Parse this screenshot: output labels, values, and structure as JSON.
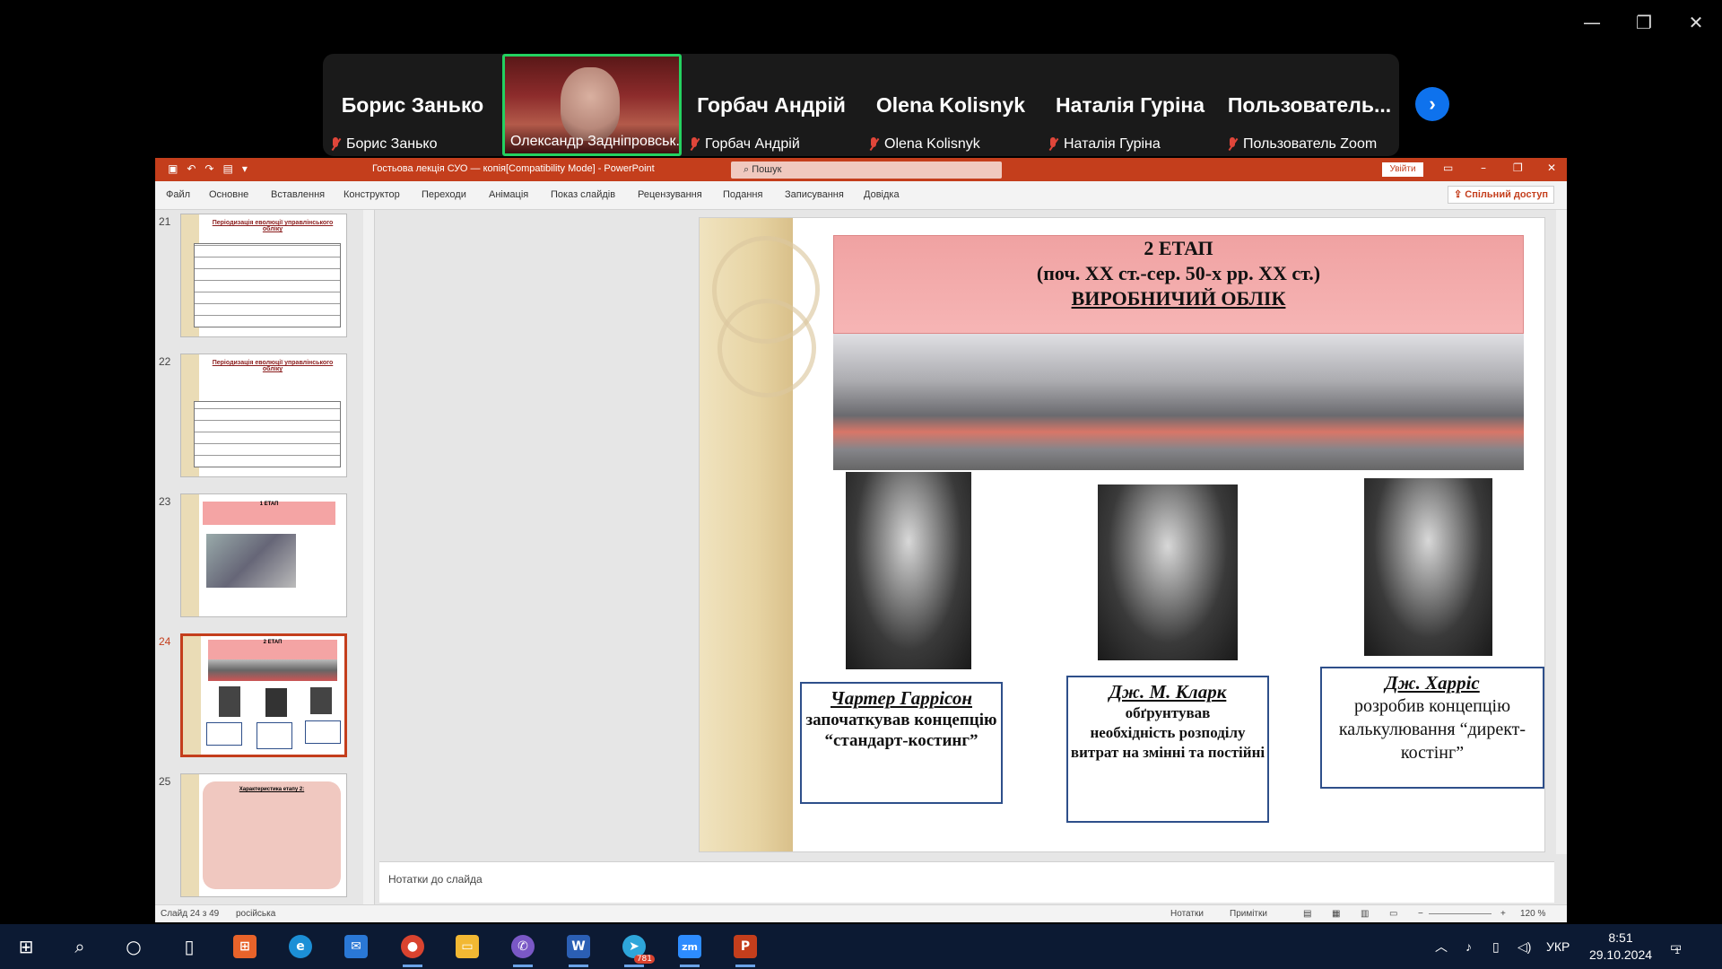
{
  "zoom": {
    "window_controls": [
      "—",
      "❐",
      "✕"
    ],
    "participants": [
      {
        "big_name": "Борис Занько",
        "label": "Борис Занько",
        "muted": true
      },
      {
        "big_name": "",
        "label": "Олександр Задніпровськ...",
        "muted": false,
        "video": true
      },
      {
        "big_name": "Горбач Андрій",
        "label": "Горбач Андрій",
        "muted": true
      },
      {
        "big_name": "Olena Kolisnyk",
        "label": "Olena Kolisnyk",
        "muted": true
      },
      {
        "big_name": "Наталія Гуріна",
        "label": "Наталія Гуріна",
        "muted": true
      },
      {
        "big_name": "Пользователь...",
        "label": "Пользователь Zoom",
        "muted": true
      }
    ],
    "next_icon": "chevron-right-icon"
  },
  "ppt": {
    "doc_title": "Гостьова лекція СУО — копія[Compatibility Mode] - PowerPoint",
    "search_placeholder": "Пошук",
    "signin": "Увійти",
    "share": "Спільний доступ",
    "ribbon_tabs": [
      "Файл",
      "Основне",
      "Вставлення",
      "Конструктор",
      "Переходи",
      "Анімація",
      "Показ слайдів",
      "Рецензування",
      "Подання",
      "Записування",
      "Довідка"
    ],
    "thumbnails": [
      {
        "num": "21",
        "title": "Періодизація еволюції управлінського обліку"
      },
      {
        "num": "22",
        "title": "Періодизація еволюції управлінського обліку"
      },
      {
        "num": "23",
        "title": "1 ЕТАП"
      },
      {
        "num": "24",
        "title": "2 ЕТАП"
      },
      {
        "num": "25",
        "title": "Характеристика етапу 2:"
      }
    ],
    "notes_placeholder": "Нотатки до слайда",
    "status": {
      "slide": "Слайд 24 з 49",
      "language": "російська",
      "notes": "Нотатки",
      "comments": "Примітки",
      "zoom": "120 %"
    }
  },
  "slide": {
    "banner_line1": "2 ЕТАП",
    "banner_line2": "(поч. ХХ ст.-сер. 50-х рр. ХХ ст.)",
    "banner_line3": "ВИРОБНИЧИЙ ОБЛІК",
    "people": [
      {
        "name": "Чартер Гаррісон",
        "desc": "започаткував концепцію “стандарт-костинг”"
      },
      {
        "name": "Дж. М. Кларк",
        "desc_bold": "обґрунтував",
        "desc": "необхідність розподілу витрат на змінні та постійні"
      },
      {
        "name": "Дж. Харріс",
        "desc": "розробив концепцію калькулювання “директ-костінг”"
      }
    ]
  },
  "taskbar": {
    "apps": [
      "start-icon",
      "search-icon",
      "cortana-icon",
      "task-view-icon",
      "store-icon",
      "edge-icon",
      "mail-icon",
      "chrome-icon",
      "explorer-icon",
      "viber-icon",
      "word-icon",
      "telegram-icon",
      "zoom-icon",
      "powerpoint-icon"
    ],
    "telegram_badge": "781",
    "language": "УКР",
    "time": "8:51",
    "date": "29.10.2024",
    "notification_count": "1"
  }
}
